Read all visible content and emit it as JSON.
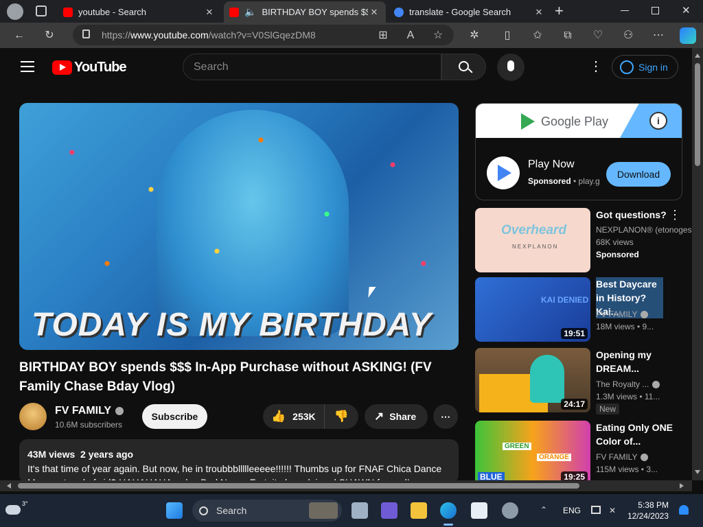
{
  "tabs": [
    {
      "title": "youtube - Search"
    },
    {
      "title": "BIRTHDAY BOY spends $$$"
    },
    {
      "title": "translate - Google Search"
    }
  ],
  "address": {
    "prefix": "https://",
    "host": "www.youtube.com",
    "path": "/watch?v=V0SlGqezDM8"
  },
  "yt": {
    "logo": "YouTube",
    "search_placeholder": "Search",
    "signin": "Sign in"
  },
  "video": {
    "overlay_text": "TODAY IS MY BIRTHDAY",
    "title": "BIRTHDAY BOY spends $$$ In-App Purchase without ASKING! (FV Family Chase Bday Vlog)",
    "channel": "FV FAMILY",
    "subscribers": "10.6M subscribers",
    "subscribe": "Subscribe",
    "likes": "253K",
    "share": "Share",
    "views": "43M views",
    "age": "2 years ago",
    "description": "It's that time of year again.  But now, he in troubbbllllleeeee!!!!!!  Thumbs up for FNAF Chica Dance Moves at end of vid? HAHAHAHA - also Bad News, Fortnite has claimed SHAWN for real!"
  },
  "ad": {
    "brand": "Google Play",
    "title": "Play Now",
    "sponsored": "Sponsored",
    "domain": "play.g",
    "cta": "Download"
  },
  "recs": [
    {
      "title": "Got questions?",
      "channel": "NEXPLANON® (etonoges",
      "meta": "68K views",
      "badge": "Sponsored",
      "thumb_text": "Overheard",
      "thumb_sub": "NEXPLANON"
    },
    {
      "title": "Best Daycare in History? Kai...",
      "channel": "FV FAMILY",
      "meta": "18M views  •  9...",
      "duration": "19:51",
      "thumb_text": "KAI DENIED"
    },
    {
      "title": "Opening my DREAM...",
      "channel": "The Royalty ...",
      "meta": "1.3M views  •  11...",
      "badge": "New",
      "duration": "24:17"
    },
    {
      "title": "Eating Only ONE Color of...",
      "channel": "FV FAMILY",
      "meta": "115M views  •  3...",
      "duration": "19:25",
      "thumb_labels": [
        "GREEN",
        "ORANGE",
        "BLUE"
      ]
    }
  ],
  "taskbar": {
    "weather": "3°",
    "search": "Search",
    "lang": "ENG",
    "time": "5:38 PM",
    "date": "12/24/2023"
  },
  "colors": {
    "yt_red": "#ff0000",
    "link_blue": "#3ea6ff",
    "ad_blue": "#65b8ff"
  }
}
